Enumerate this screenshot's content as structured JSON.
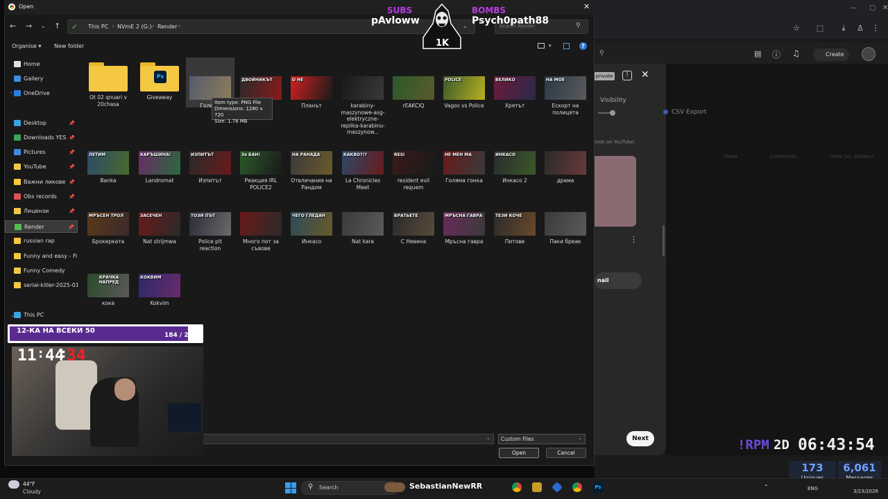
{
  "dialog": {
    "title": "Open",
    "breadcrumb": [
      "This PC",
      "NVmE 2 (G:)",
      "Render"
    ],
    "search_placeholder": "Search Render",
    "organise_label": "Organise",
    "new_folder_label": "New folder",
    "file_type": "Custom Files",
    "open_label": "Open",
    "cancel_label": "Cancel",
    "tooltip": {
      "line1": "Item type: PNG File",
      "line2": "Dimensions: 1280 x 720",
      "line3": "Size: 1.78 MB"
    }
  },
  "sidebar": {
    "items": [
      {
        "label": "Home",
        "icon": "home-icon",
        "color": "#e0e0e0"
      },
      {
        "label": "Gallery",
        "icon": "gallery-icon",
        "color": "#3b8de0"
      },
      {
        "label": "OneDrive",
        "icon": "cloud-icon",
        "color": "#2a7de1"
      },
      {
        "label": "Desktop",
        "icon": "desktop-icon",
        "color": "#3ba3e0"
      },
      {
        "label": "Downloads YES",
        "icon": "download-icon",
        "color": "#3ba35a"
      },
      {
        "label": "Pictures",
        "icon": "pictures-icon",
        "color": "#3b8de0"
      },
      {
        "label": "YouTube",
        "icon": "folder-icon",
        "color": "#f5c842"
      },
      {
        "label": "Важни ликове",
        "icon": "folder-icon",
        "color": "#f5c842"
      },
      {
        "label": "Obs records",
        "icon": "obs-icon",
        "color": "#e05050"
      },
      {
        "label": "Лицензи",
        "icon": "folder-icon",
        "color": "#f5c842"
      },
      {
        "label": "Render",
        "icon": "check-icon",
        "color": "#4fbf4f"
      },
      {
        "label": "russian rap",
        "icon": "folder-icon",
        "color": "#f5c842"
      },
      {
        "label": "Funny and easy - Fi",
        "icon": "folder-icon",
        "color": "#f5c842"
      },
      {
        "label": "Funny Comedy",
        "icon": "folder-icon",
        "color": "#f5c842"
      },
      {
        "label": "serial-killer-2025-01",
        "icon": "folder-icon",
        "color": "#f5c842"
      },
      {
        "label": "This PC",
        "icon": "pc-icon",
        "color": "#3ba3e0"
      }
    ]
  },
  "files": {
    "row1": [
      {
        "name": "Ot 02 qnuari v 20chasa",
        "kind": "folder"
      },
      {
        "name": "Giveaway",
        "kind": "folder-ps"
      },
      {
        "name": "Големи",
        "kind": "thumb",
        "c1": "#3a3f55",
        "c2": "#7a6a40",
        "text": ""
      },
      {
        "name": "П",
        "kind": "thumb",
        "c1": "#2a2a2a",
        "c2": "#8a1a1a",
        "text": "ДВОЙНИКЪТ"
      },
      {
        "name": "Планът",
        "kind": "thumb",
        "c1": "#d02020",
        "c2": "#1a1a1a",
        "text": "О НЕ"
      },
      {
        "name": "karabiny-maszynowe-asg-elektryczne-replika-karabinu-maszynow...",
        "kind": "thumb",
        "c1": "#191919",
        "c2": "#3a3a3a",
        "text": ""
      },
      {
        "name": "rEAKCIQ",
        "kind": "thumb",
        "c1": "#2b5a2b",
        "c2": "#5a5a2b",
        "text": ""
      },
      {
        "name": "Vagos vs Police",
        "kind": "thumb",
        "c1": "#3a5a2b",
        "c2": "#b8b020",
        "text": "POLICE"
      },
      {
        "name": "Хрятът",
        "kind": "thumb",
        "c1": "#6a1a3a",
        "c2": "#2a2a4a",
        "text": "ВЕЛИКО"
      },
      {
        "name": "Ескорт на полицята",
        "kind": "thumb",
        "c1": "#2a3a4a",
        "c2": "#5a5a5a",
        "text": "НА МОЕ"
      }
    ],
    "row2": [
      {
        "name": "Banka",
        "kind": "thumb",
        "c1": "#2a4a6a",
        "c2": "#4a6a2a",
        "text": "ЛЕТИМ"
      },
      {
        "name": "Landromat",
        "kind": "thumb",
        "c1": "#6a2a6a",
        "c2": "#2a6a3a",
        "text": "КАРЪШИНА!"
      },
      {
        "name": "Изпитът",
        "kind": "thumb",
        "c1": "#2a2a2a",
        "c2": "#6a1a1a",
        "text": "ИЗПИТЪТ"
      },
      {
        "name": "Реакция IRL POLICE2",
        "kind": "thumb",
        "c1": "#2a5a2a",
        "c2": "#1a1a1a",
        "text": "3я БАН!"
      },
      {
        "name": "Отвличания на Рандом",
        "kind": "thumb",
        "c1": "#3a3a3a",
        "c2": "#6a5a2a",
        "text": "НА РАНАДА"
      },
      {
        "name": "La Chronicles Meet",
        "kind": "thumb",
        "c1": "#2a4a6a",
        "c2": "#6a1a1a",
        "text": "КАКВО?!?"
      },
      {
        "name": "resident evil requem",
        "kind": "thumb",
        "c1": "#3a1a1a",
        "c2": "#1a1a1a",
        "text": "RESI"
      },
      {
        "name": "Голяма гонка",
        "kind": "thumb",
        "c1": "#6a1a1a",
        "c2": "#3a3a3a",
        "text": "НЕ МЕН МА"
      },
      {
        "name": "Инкасо 2",
        "kind": "thumb",
        "c1": "#2a2a2a",
        "c2": "#3a5a2a",
        "text": "ИНКАСО"
      },
      {
        "name": "драма",
        "kind": "thumb",
        "c1": "#2a2a2a",
        "c2": "#6a3a3a",
        "text": ""
      }
    ],
    "row3": [
      {
        "name": "Брокерката",
        "kind": "thumb",
        "c1": "#5a3a1a",
        "c2": "#3a2a2a",
        "text": "МРЪСЕН ТРОЛ"
      },
      {
        "name": "Nat strijmwa",
        "kind": "thumb",
        "c1": "#6a1a1a",
        "c2": "#2a2a2a",
        "text": "ЗАСЕЧЕН"
      },
      {
        "name": "Police pit reaction",
        "kind": "thumb",
        "c1": "#2a2a3a",
        "c2": "#6a6a6a",
        "text": "ТОЗИ ПЪТ"
      },
      {
        "name": "Много пот за съвове",
        "kind": "thumb",
        "c1": "#6a1a1a",
        "c2": "#2a2a2a",
        "text": ""
      },
      {
        "name": "Инкасо",
        "kind": "thumb",
        "c1": "#2a4a5a",
        "c2": "#6a5a2a",
        "text": "ЧЕГО ГЛЕДАН"
      },
      {
        "name": "Nat kara",
        "kind": "thumb",
        "c1": "#3a3a3a",
        "c2": "#5a5a5a",
        "text": ""
      },
      {
        "name": "С Невена",
        "kind": "thumb",
        "c1": "#2a2a2a",
        "c2": "#5a4a3a",
        "text": "БРАТЬЕТЕ"
      },
      {
        "name": "Мръсна гавра",
        "kind": "thumb",
        "c1": "#6a2a5a",
        "c2": "#3a3a3a",
        "text": "МРЪСНА ГАВРА"
      },
      {
        "name": "Питове",
        "kind": "thumb",
        "c1": "#2a2a2a",
        "c2": "#6a4a2a",
        "text": "ТЕЗИ КОЧЕ"
      },
      {
        "name": "Паки бреак",
        "kind": "thumb",
        "c1": "#3a3a3a",
        "c2": "#5a5a5a",
        "text": ""
      }
    ],
    "row4": [
      {
        "name": "кока",
        "kind": "thumb",
        "c1": "#2a4a2a",
        "c2": "#5a5a5a",
        "text": "КРАЧКА НАПРЕД"
      },
      {
        "name": "Kokvim",
        "kind": "thumb",
        "c1": "#2a2a6a",
        "c2": "#6a2a6a",
        "text": "КОКВИМ"
      }
    ]
  },
  "browser": {
    "create_label": "Create",
    "private_label": "private",
    "visibility_label": "Visibility",
    "csv_export_label": "CSV Export",
    "look_label": "look on YouTube:",
    "col_views": "Views",
    "col_comments": "Comments",
    "col_likes": "Likes (vs. dislikes)",
    "email_label": "nail",
    "next_label": "Next"
  },
  "stream": {
    "subs_label": "SUBS",
    "bombs_label": "BOMBS",
    "sub_name": "pAvloww",
    "bomb_name": "Psych0path88",
    "mascot_count": "1K",
    "goal_label": "12-КА НА ВСЕКИ 50",
    "goal_count": "184 / 200",
    "goal_progress": 0.92,
    "clock_h": "11",
    "clock_m": "44",
    "clock_s": "34",
    "rpm_label": "!RPM",
    "rpm_days": "2D",
    "rpm_time": "06:43:54",
    "uniques_value": "173",
    "uniques_label": "Uniques",
    "messages_value": "6,061",
    "messages_label": "Messages"
  },
  "taskbar": {
    "weather_temp": "44°F",
    "weather_desc": "Cloudy",
    "search_label": "Search",
    "ticker": "SebastianNewRR",
    "lang": "ENG",
    "date": "3/23/2026"
  }
}
